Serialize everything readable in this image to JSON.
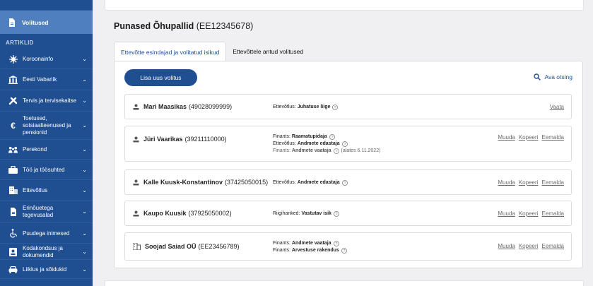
{
  "sidebar": {
    "active_label": "Volitused",
    "section_label": "ARTIKLID",
    "items": [
      {
        "label": "Koroonainfo",
        "icon": "virus-icon"
      },
      {
        "label": "Eesti Vabariik",
        "icon": "government-building-icon"
      },
      {
        "label": "Tervis ja tervisekaitse",
        "icon": "health-icon"
      },
      {
        "label": "Toetused, sotsiaalteenused ja pensionid",
        "icon": "euro-icon"
      },
      {
        "label": "Perekond",
        "icon": "family-icon"
      },
      {
        "label": "Töö ja töösuhted",
        "icon": "briefcase-icon"
      },
      {
        "label": "Ettevõtlus",
        "icon": "building-icon"
      },
      {
        "label": "Erinõuetega tegevusalad",
        "icon": "document-icon"
      },
      {
        "label": "Puudega inimesed",
        "icon": "wheelchair-icon"
      },
      {
        "label": "Kodakondsus ja dokumendid",
        "icon": "id-card-icon"
      },
      {
        "label": "Liiklus ja sõidukid",
        "icon": "car-icon"
      }
    ]
  },
  "company": {
    "name": "Punased Õhupallid",
    "code": "(EE12345678)"
  },
  "tabs": [
    {
      "label": "Ettevõtte esindajad ja volitatud isikud",
      "active": true
    },
    {
      "label": "Ettevõttele antud volitused",
      "active": false
    }
  ],
  "toolbar": {
    "add_label": "Lisa uus volitus",
    "search_label": "Ava otsing"
  },
  "rows": [
    {
      "name": "Mari Maasikas",
      "id": "(49028099999)",
      "type": "person",
      "roles": [
        {
          "prefix": "Ettevõtlus:",
          "role": "Juhatuse liige",
          "muted": false,
          "since": ""
        }
      ],
      "actions": [
        "Vaata"
      ]
    },
    {
      "name": "Jüri Vaarikas",
      "id": "(39211110000)",
      "type": "person",
      "roles": [
        {
          "prefix": "Finants:",
          "role": "Raamatupidaja",
          "muted": false,
          "since": ""
        },
        {
          "prefix": "Ettevõtlus:",
          "role": "Andmete edastaja",
          "muted": false,
          "since": ""
        },
        {
          "prefix": "Finants:",
          "role": "Andmete vaataja",
          "muted": true,
          "since": "(alates 6.11.2022)"
        }
      ],
      "actions": [
        "Muuda",
        "Kopeeri",
        "Eemalda"
      ]
    },
    {
      "name": "Kalle Kuusk-Konstantinov",
      "id": "(37425050015)",
      "type": "person",
      "roles": [
        {
          "prefix": "Ettevõtlus:",
          "role": "Andmete edastaja",
          "muted": false,
          "since": ""
        }
      ],
      "actions": [
        "Muuda",
        "Kopeeri",
        "Eemalda"
      ]
    },
    {
      "name": "Kaupo Kuusik",
      "id": "(37925050002)",
      "type": "person",
      "roles": [
        {
          "prefix": "Riigihanked:",
          "role": "Vastutav isik",
          "muted": false,
          "since": ""
        }
      ],
      "actions": [
        "Muuda",
        "Kopeeri",
        "Eemalda"
      ]
    },
    {
      "name": "Soojad Saiad OÜ",
      "id": "(EE23456789)",
      "type": "company",
      "roles": [
        {
          "prefix": "Finants:",
          "role": "Andmete vaataja",
          "muted": false,
          "since": ""
        },
        {
          "prefix": "Finants:",
          "role": "Arvestuse rakendus",
          "muted": false,
          "since": ""
        }
      ],
      "actions": [
        "Muuda",
        "Kopeeri",
        "Eemalda"
      ]
    }
  ],
  "colors": {
    "sidebar_bg": "#1f4f91",
    "sidebar_active": "#4f7fbf",
    "accent": "#1f4f91",
    "page_bg": "#f0f0f2"
  }
}
